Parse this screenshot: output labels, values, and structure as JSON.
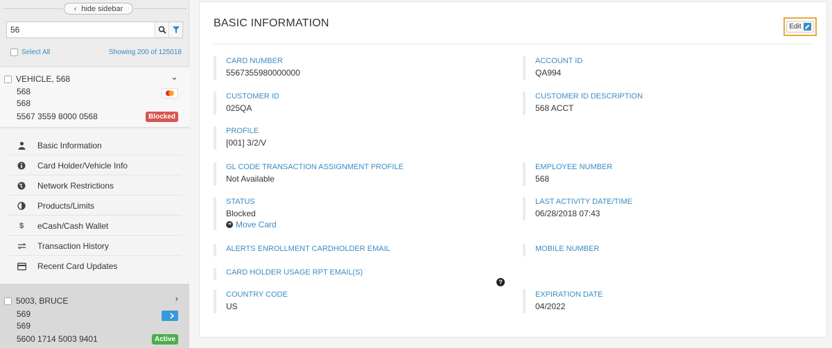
{
  "sidebar": {
    "hide_label": "hide sidebar",
    "search_value": "56",
    "select_all": "Select All",
    "showing": "Showing 200 of 125018",
    "cards": [
      {
        "name": "VEHICLE, 568",
        "line1": "568",
        "line2": "568",
        "number": "5567 3559 8000 0568",
        "status": "Blocked",
        "status_color": "#d9534f",
        "brand": "mastercard"
      },
      {
        "name": "5003, BRUCE",
        "line1": "569",
        "line2": "569",
        "number": "5600 1714 5003 9401",
        "status": "Active",
        "status_color": "#4cae4c",
        "brand": "card-blue"
      }
    ],
    "menu": [
      {
        "label": "Basic Information",
        "icon": "user-icon"
      },
      {
        "label": "Card Holder/Vehicle Info",
        "icon": "info-icon"
      },
      {
        "label": "Network Restrictions",
        "icon": "globe-icon"
      },
      {
        "label": "Products/Limits",
        "icon": "half-circle-icon"
      },
      {
        "label": "eCash/Cash Wallet",
        "icon": "dollar-icon"
      },
      {
        "label": "Transaction History",
        "icon": "transfer-icon"
      },
      {
        "label": "Recent Card Updates",
        "icon": "card-icon"
      }
    ]
  },
  "panel": {
    "title": "BASIC INFORMATION",
    "edit_label": "Edit",
    "fields": {
      "card_number": {
        "label": "CARD NUMBER",
        "value": "5567355980000000"
      },
      "account_id": {
        "label": "ACCOUNT ID",
        "value": "QA994"
      },
      "customer_id": {
        "label": "CUSTOMER ID",
        "value": "025QA"
      },
      "customer_id_desc": {
        "label": "CUSTOMER ID DESCRIPTION",
        "value": "568 ACCT"
      },
      "profile": {
        "label": "PROFILE",
        "value": "[001] 3/2/V"
      },
      "gl_code": {
        "label": "GL CODE TRANSACTION ASSIGNMENT PROFILE",
        "value": "Not Available"
      },
      "employee_number": {
        "label": "EMPLOYEE NUMBER",
        "value": "568"
      },
      "status": {
        "label": "STATUS",
        "value": "Blocked",
        "link": "Move Card"
      },
      "last_activity": {
        "label": "LAST ACTIVITY DATE/TIME",
        "value": "06/28/2018 07:43"
      },
      "alerts_email": {
        "label": "ALERTS ENROLLMENT CARDHOLDER EMAIL",
        "value": ""
      },
      "mobile_number": {
        "label": "MOBILE NUMBER",
        "value": ""
      },
      "usage_rpt_email": {
        "label": "CARD HOLDER USAGE RPT EMAIL(S)",
        "value": ""
      },
      "country_code": {
        "label": "COUNTRY CODE",
        "value": "US"
      },
      "expiration_date": {
        "label": "EXPIRATION DATE",
        "value": "04/2022"
      }
    }
  },
  "colors": {
    "accent": "#3a8bc4",
    "highlight": "#f0a53a"
  }
}
